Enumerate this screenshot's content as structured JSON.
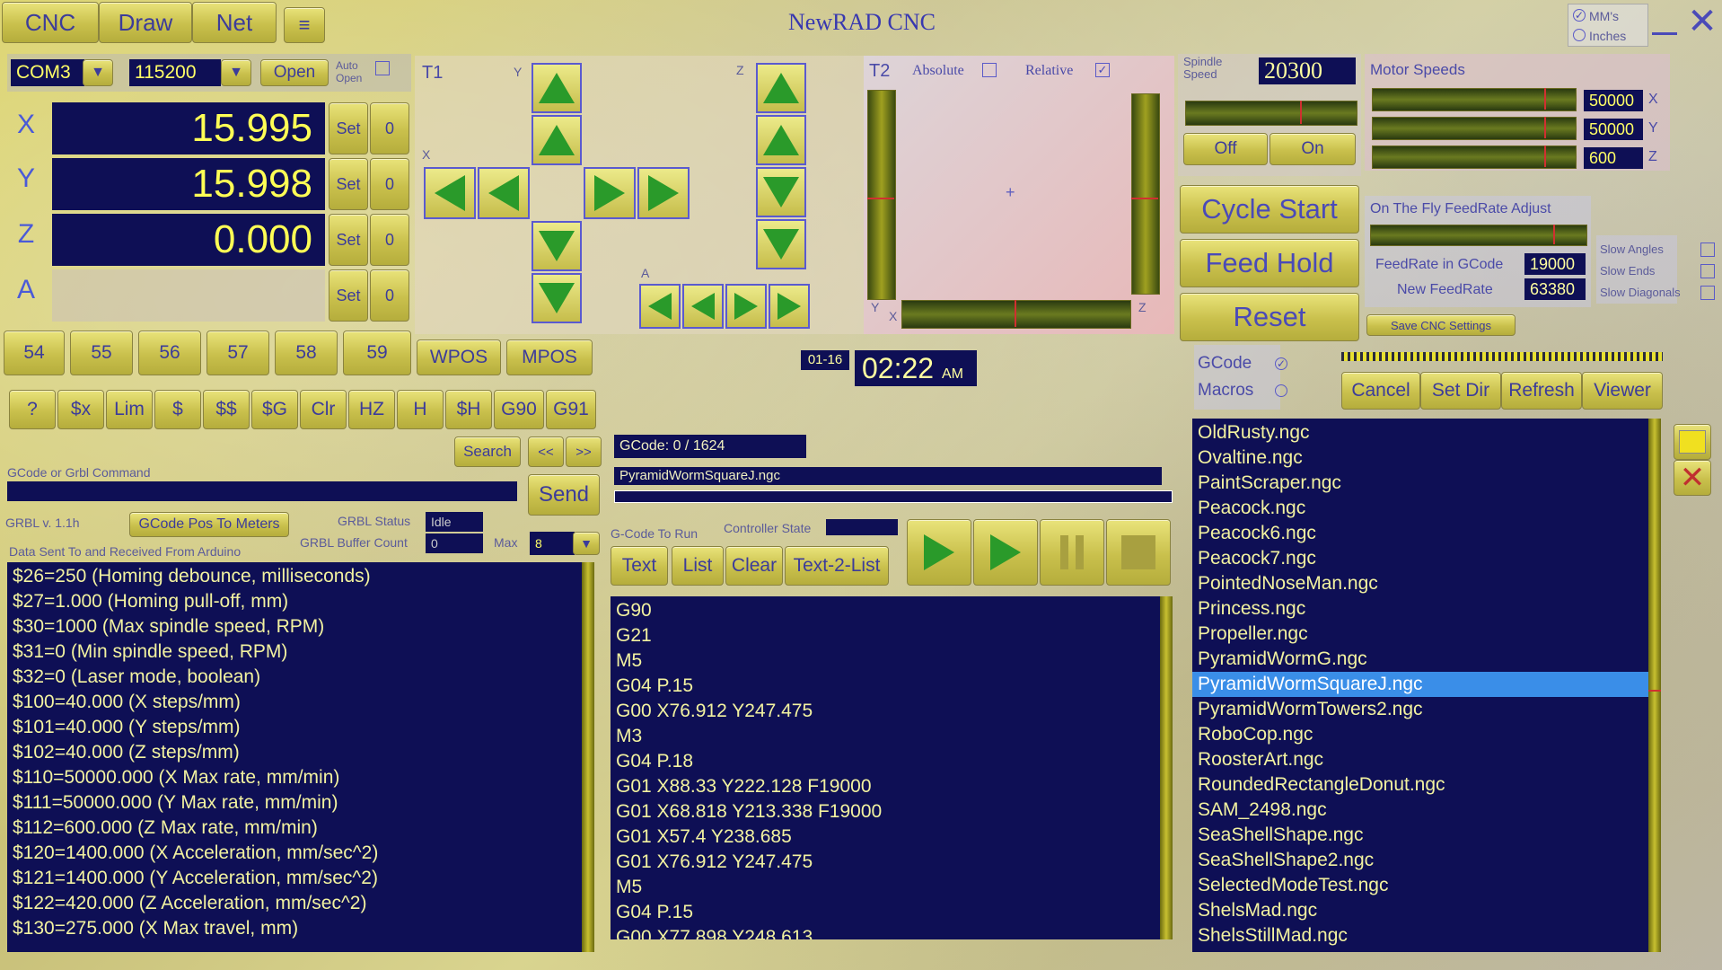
{
  "title": "NewRAD CNC",
  "top_tabs": [
    "CNC",
    "Draw",
    "Net"
  ],
  "units": {
    "mm": "MM's",
    "inches": "Inches"
  },
  "connection": {
    "port": "COM3",
    "baud": "115200",
    "open": "Open",
    "auto_open": "Auto Open"
  },
  "axes": [
    {
      "name": "X",
      "value": "15.995"
    },
    {
      "name": "Y",
      "value": "15.998"
    },
    {
      "name": "Z",
      "value": "0.000"
    },
    {
      "name": "A",
      "value": ""
    }
  ],
  "set_label": "Set",
  "zero_label": "0",
  "wcs_buttons": [
    "54",
    "55",
    "56",
    "57",
    "58",
    "59"
  ],
  "wpos": "WPOS",
  "mpos": "MPOS",
  "cmd_buttons": [
    "?",
    "$x",
    "Lim",
    "$",
    "$$",
    "$G",
    "Clr",
    "HZ",
    "H",
    "$H",
    "G90",
    "G91"
  ],
  "search": "Search",
  "prev": "<<",
  "next": ">>",
  "gcode_cmd_label": "GCode or Grbl Command",
  "send": "Send",
  "grbl_version": "GRBL v. 1.1h",
  "gcode_pos_btn": "GCode Pos To Meters",
  "grbl_status_label": "GRBL Status",
  "grbl_status": "Idle",
  "buffer_label": "GRBL Buffer Count",
  "buffer_count": "0",
  "max_label": "Max",
  "max_value": "8",
  "data_label": "Data Sent To and Received From Arduino",
  "grbl_settings": [
    "$26=250 (Homing debounce, milliseconds)",
    "$27=1.000 (Homing pull-off, mm)",
    "$30=1000 (Max spindle speed, RPM)",
    "$31=0 (Min spindle speed, RPM)",
    "$32=0 (Laser mode, boolean)",
    "$100=40.000 (X steps/mm)",
    "$101=40.000 (Y steps/mm)",
    "$102=40.000 (Z steps/mm)",
    "$110=50000.000 (X Max rate, mm/min)",
    "$111=50000.000 (Y Max rate, mm/min)",
    "$112=600.000 (Z Max rate, mm/min)",
    "$120=1400.000 (X Acceleration, mm/sec^2)",
    "$121=1400.000 (Y Acceleration, mm/sec^2)",
    "$122=420.000 (Z Acceleration, mm/sec^2)",
    "$130=275.000 (X Max travel, mm)"
  ],
  "t1": {
    "label": "T1",
    "x": "X",
    "y": "Y",
    "z": "Z",
    "a": "A"
  },
  "t2": {
    "label": "T2",
    "absolute": "Absolute",
    "relative": "Relative",
    "check": "✓",
    "y": "Y",
    "x": "X",
    "z": "Z"
  },
  "spindle": {
    "label": "Spindle Speed",
    "value": "20300",
    "off": "Off",
    "on": "On"
  },
  "motor_speeds": {
    "label": "Motor Speeds",
    "rows": [
      {
        "value": "50000",
        "axis": "X"
      },
      {
        "value": "50000",
        "axis": "Y"
      },
      {
        "value": "600",
        "axis": "Z"
      }
    ]
  },
  "cycle_start": "Cycle Start",
  "feed_hold": "Feed Hold",
  "reset": "Reset",
  "feedrate": {
    "label": "On The Fly FeedRate Adjust",
    "gcode_label": "FeedRate in GCode",
    "gcode_value": "19000",
    "new_label": "New FeedRate",
    "new_value": "63380"
  },
  "slow": {
    "angles": "Slow Angles",
    "ends": "Slow Ends",
    "diagonals": "Slow Diagonals"
  },
  "save_settings": "Save CNC Settings",
  "date": "01-16",
  "time": "02:22",
  "ampm": "AM",
  "gcode_progress": "GCode: 0 / 1624",
  "current_file": "PyramidWormSquareJ.ngc",
  "gcode_to_run": "G-Code To Run",
  "controller_state": "Controller State",
  "list_buttons": [
    "Text",
    "List",
    "Clear",
    "Text-2-List"
  ],
  "gcode_lines": [
    "G90",
    "G21",
    "M5",
    "G04 P.15",
    "G00 X76.912 Y247.475",
    "M3",
    "G04 P.18",
    "G01 X88.33 Y222.128 F19000",
    "G01 X68.818 Y213.338 F19000",
    "G01 X57.4 Y238.685",
    "G01 X76.912 Y247.475",
    "M5",
    "G04 P.15",
    "G00 X77.898 Y248.613"
  ],
  "file_panel": {
    "gcode": "GCode",
    "macros": "Macros",
    "check": "✓",
    "cancel": "Cancel",
    "set_dir": "Set Dir",
    "refresh": "Refresh",
    "viewer": "Viewer"
  },
  "files": [
    "OldRusty.ngc",
    "Ovaltine.ngc",
    "PaintScraper.ngc",
    "Peacock.ngc",
    "Peacock6.ngc",
    "Peacock7.ngc",
    "PointedNoseMan.ngc",
    "Princess.ngc",
    "Propeller.ngc",
    "PyramidWormG.ngc",
    "PyramidWormSquareJ.ngc",
    "PyramidWormTowers2.ngc",
    "RoboCop.ngc",
    "RoosterArt.ngc",
    "RoundedRectangleDonut.ngc",
    "SAM_2498.ngc",
    "SeaShellShape.ngc",
    "SeaShellShape2.ngc",
    "SelectedModeTest.ngc",
    "ShelsMad.ngc",
    "ShelsStillMad.ngc"
  ],
  "selected_file_index": 10,
  "colors": {
    "navy": "#0e0f55",
    "yellow_text": "#ffff55",
    "selection": "#3a8ee8",
    "arrow": "#2a9a2a"
  }
}
